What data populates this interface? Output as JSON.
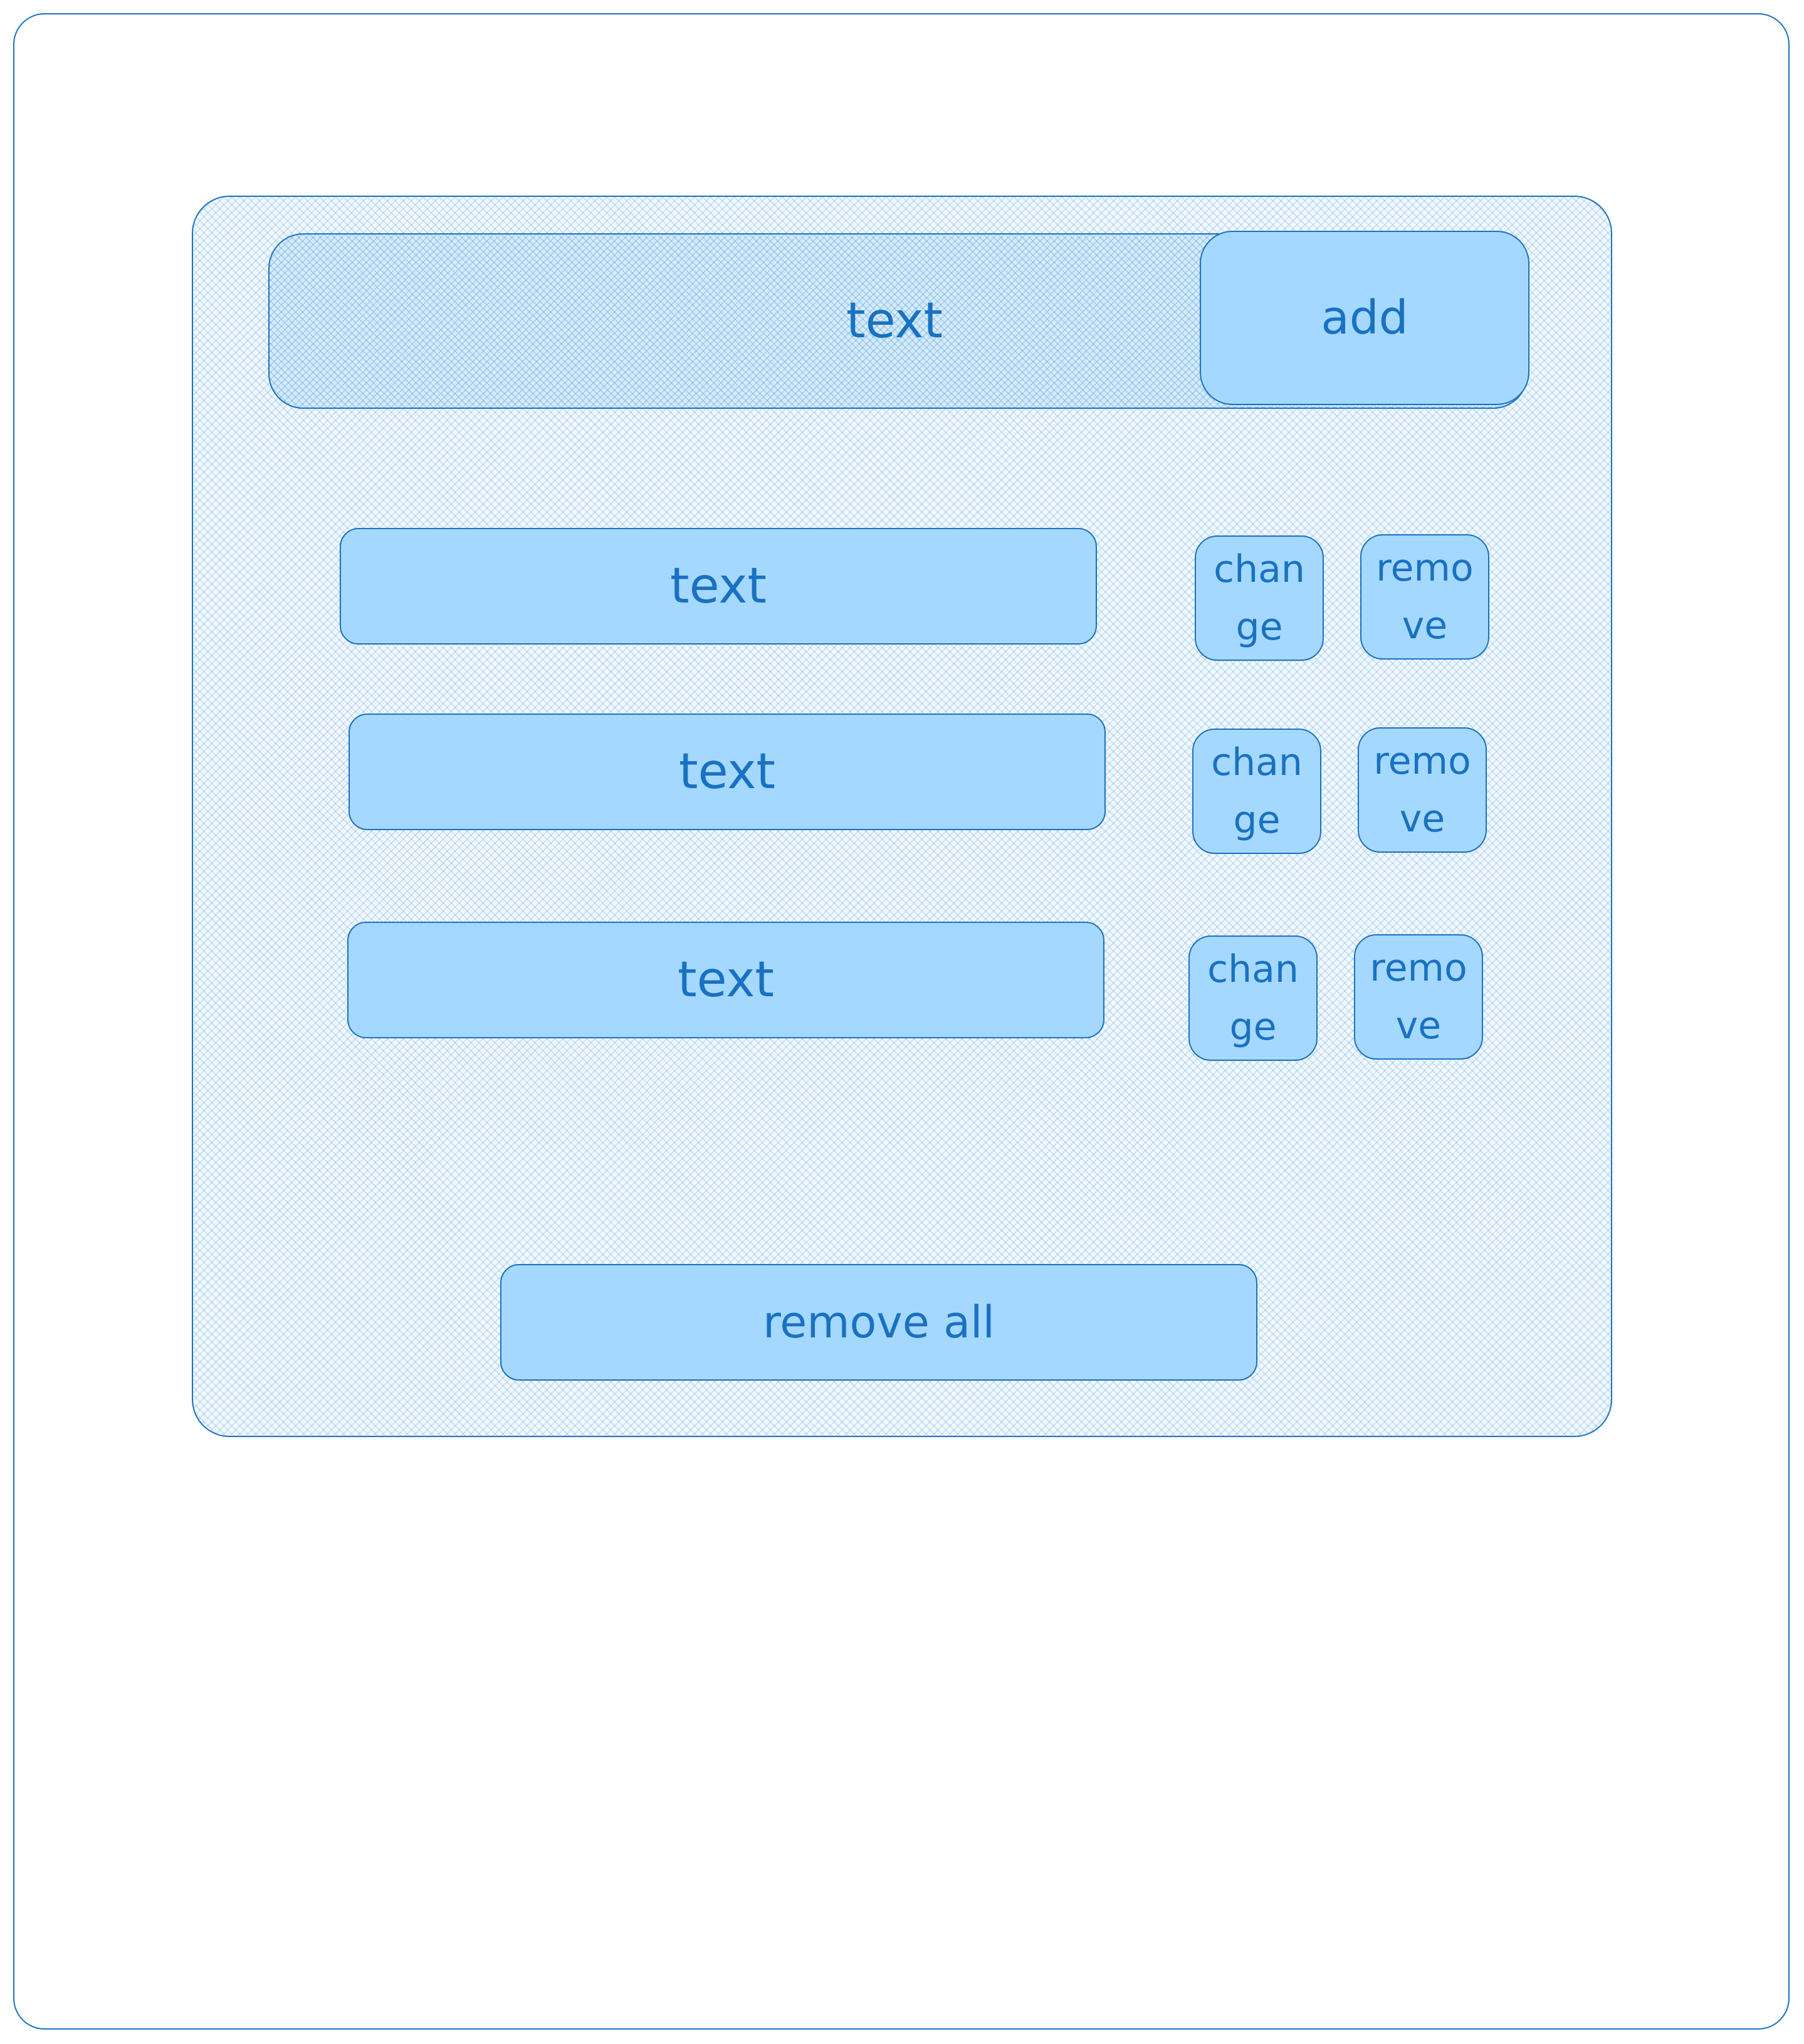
{
  "input": {
    "value": "text",
    "add_label": "add"
  },
  "items": [
    {
      "label": "text",
      "change_label": "change",
      "remove_label": "remove"
    },
    {
      "label": "text",
      "change_label": "change",
      "remove_label": "remove"
    },
    {
      "label": "text",
      "change_label": "change",
      "remove_label": "remove"
    }
  ],
  "footer": {
    "remove_all_label": "remove all"
  },
  "colors": {
    "stroke": "#1971c2",
    "fill": "#a5d8ff",
    "panel_fill": "#f0f8fe"
  }
}
